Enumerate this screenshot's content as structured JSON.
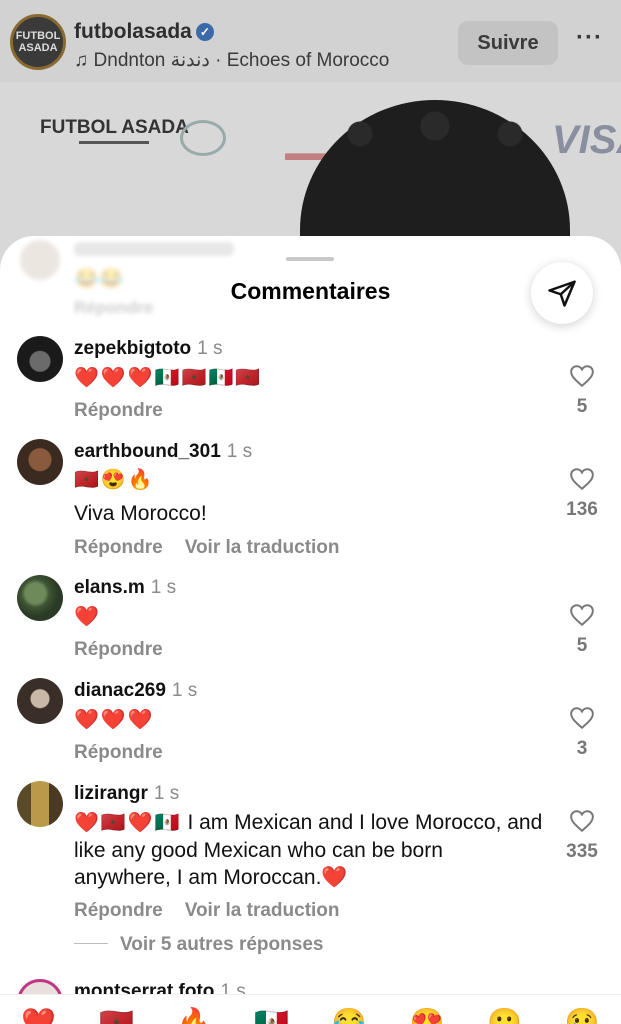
{
  "background_post": {
    "username": "futbolasada",
    "logo_text": "FUTBOL ASADA",
    "music": "♫ Dndnton دندنة · Echoes of Morocco",
    "follow_label": "Suivre",
    "more_label": "···",
    "sponsor_futbol": "FUTBOL ASADA",
    "sponsor_visa": "VISA"
  },
  "sheet": {
    "title": "Commentaires",
    "filter_icon": "paper-plane-icon",
    "ghost_reply": "Répondre",
    "ghost_emoji": "😂😂"
  },
  "comments": [
    {
      "username": "zepekbigtoto",
      "time": "1 s",
      "emojis": "❤️❤️❤️🇲🇽🇲🇦🇲🇽🇲🇦",
      "text": "",
      "reply": "Répondre",
      "translate": "",
      "likes": "5"
    },
    {
      "username": "earthbound_301",
      "time": "1 s",
      "emojis": "🇲🇦😍🔥",
      "text": "Viva Morocco!",
      "reply": "Répondre",
      "translate": "Voir la traduction",
      "likes": "136"
    },
    {
      "username": "elans.m",
      "time": "1 s",
      "emojis": "❤️",
      "text": "",
      "reply": "Répondre",
      "translate": "",
      "likes": "5"
    },
    {
      "username": "dianac269",
      "time": "1 s",
      "emojis": "❤️❤️❤️",
      "text": "",
      "reply": "Répondre",
      "translate": "",
      "likes": "3"
    },
    {
      "username": "lizirangr",
      "time": "1 s",
      "emojis": "❤️🇲🇦❤️🇲🇽",
      "text": "I am Mexican and I love Morocco, and like any good Mexican who can be born anywhere, I am Moroccan.❤️",
      "reply": "Répondre",
      "translate": "Voir la traduction",
      "likes": "335",
      "more_replies": "Voir 5 autres réponses"
    },
    {
      "username": "montserrat.foto",
      "time": "1 s"
    }
  ],
  "reaction_bar": [
    "❤️",
    "🇲🇦",
    "🔥",
    "🇲🇽",
    "😂",
    "😍",
    "😮",
    "😢"
  ],
  "colors": {
    "text": "#000000",
    "secondary": "#8a8a8a",
    "sheet_bg": "#ffffff",
    "dimmed_bg": "#cfcfcf"
  }
}
